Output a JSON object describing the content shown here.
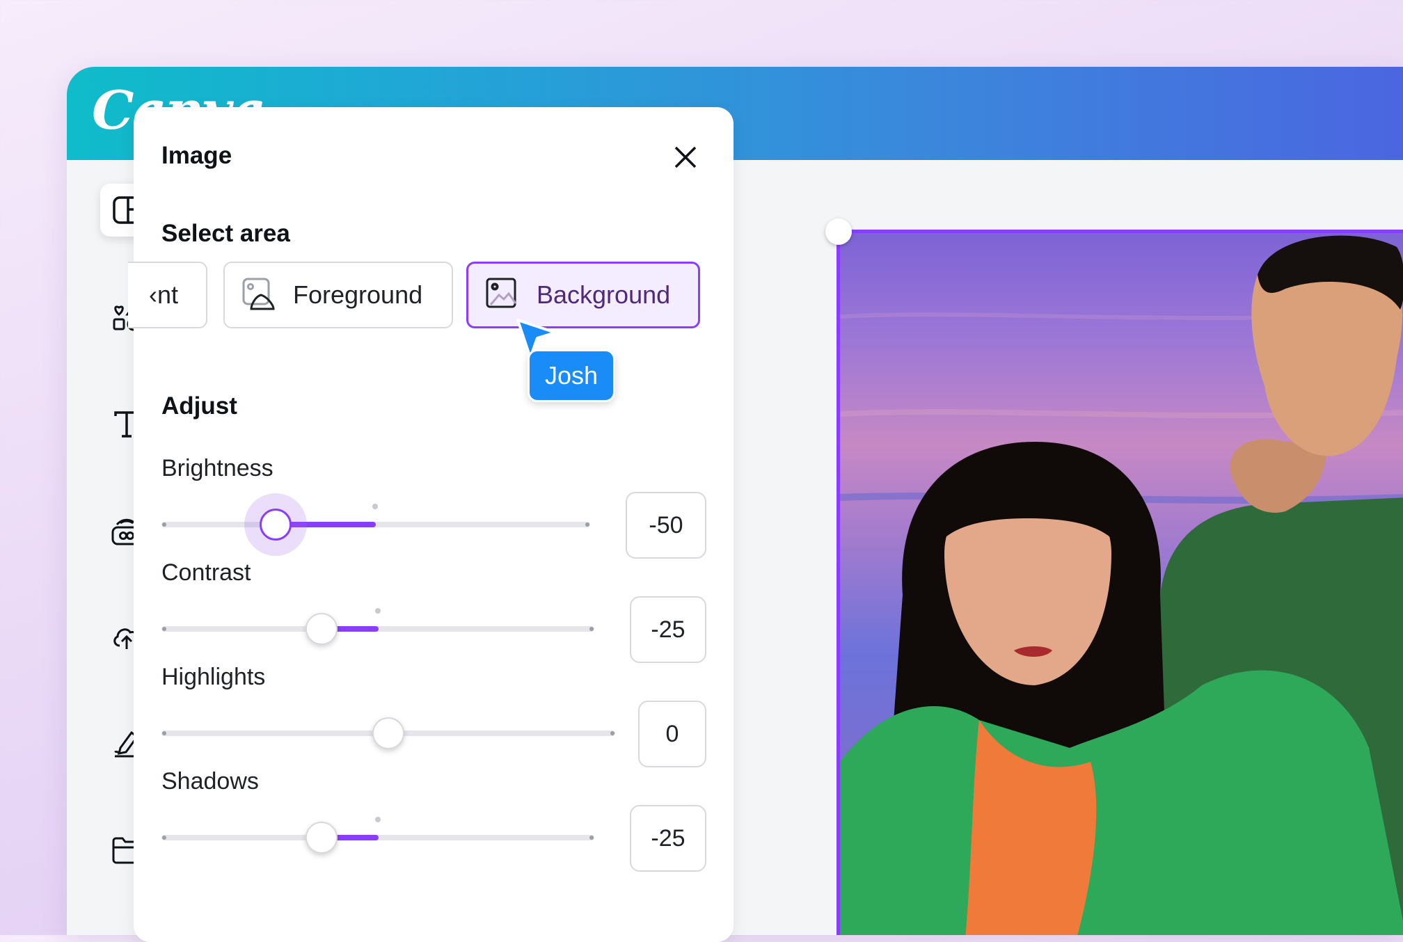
{
  "app": {
    "logo": "Canva"
  },
  "rail": {
    "items": [
      {
        "icon": "design-layout-icon",
        "active": true
      },
      {
        "icon": "elements-shapes-icon",
        "active": false
      },
      {
        "icon": "text-icon",
        "active": false
      },
      {
        "icon": "brand-kit-icon",
        "active": false
      },
      {
        "icon": "upload-cloud-icon",
        "active": false
      },
      {
        "icon": "draw-pen-icon",
        "active": false
      },
      {
        "icon": "projects-folder-icon",
        "active": false
      }
    ]
  },
  "panel": {
    "title": "Image",
    "select_area": {
      "title": "Select area",
      "options": [
        {
          "label": "nt",
          "icon": "chevron-left-icon"
        },
        {
          "label": "Foreground",
          "icon": "image-foreground-icon"
        },
        {
          "label": "Background",
          "icon": "image-background-icon",
          "selected": true
        }
      ]
    },
    "collaborator": {
      "name": "Josh",
      "color": "#1a8cf7"
    },
    "adjust": {
      "title": "Adjust",
      "sliders": [
        {
          "label": "Brightness",
          "value": "-50",
          "level": -50,
          "active": true
        },
        {
          "label": "Contrast",
          "value": "-25",
          "level": -25
        },
        {
          "label": "Highlights",
          "value": "0",
          "level": 0
        },
        {
          "label": "Shadows",
          "value": "-25",
          "level": -25
        }
      ]
    }
  },
  "colors": {
    "accent": "#8b3dff",
    "collab": "#1a8cf7"
  }
}
